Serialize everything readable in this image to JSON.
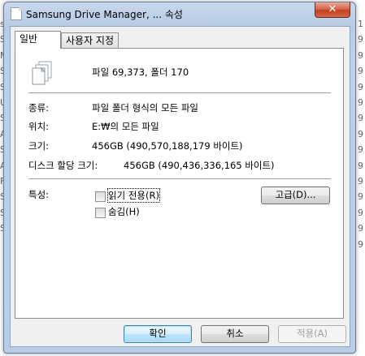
{
  "background": {
    "right_column": [
      "1",
      "9",
      "9",
      "9",
      "9",
      "9",
      "9",
      "9",
      "9",
      "9",
      "9",
      "9",
      "9",
      "9",
      "9"
    ],
    "left_column": [
      "s",
      "S",
      "M",
      "S",
      "S",
      "U",
      "S",
      "A",
      "S",
      "A",
      "F",
      "S",
      "S",
      "S"
    ]
  },
  "window": {
    "title": "Samsung Drive Manager, ... 속성",
    "close_glyph": "✕"
  },
  "tabs": [
    {
      "label": "일반",
      "active": true
    },
    {
      "label": "사용자 지정",
      "active": false
    }
  ],
  "general": {
    "summary": "파일 69,373, 폴더 170",
    "rows": [
      {
        "label": "종류:",
        "value": "파일 폴더 형식의 모든 파일"
      },
      {
        "label": "위치:",
        "value": "E:₩의 모든 파일"
      },
      {
        "label": "크기:",
        "value": "456GB (490,570,188,179 바이트)"
      },
      {
        "label": "디스크 할당 크기:",
        "value": "456GB (490,436,336,165 바이트)"
      }
    ],
    "attributes_label": "특성:",
    "readonly_label": "읽기 전용(R)",
    "hidden_label": "숨김(H)",
    "advanced_label": "고급(D)..."
  },
  "buttons": {
    "ok": "확인",
    "cancel": "취소",
    "apply": "적용(A)"
  },
  "colors": {
    "frame": "#b9cde6",
    "close": "#c2401e",
    "primary_border": "#3c7fb1"
  },
  "icons": {
    "title": "document-stack-icon",
    "folder": "multiple-files-icon"
  }
}
